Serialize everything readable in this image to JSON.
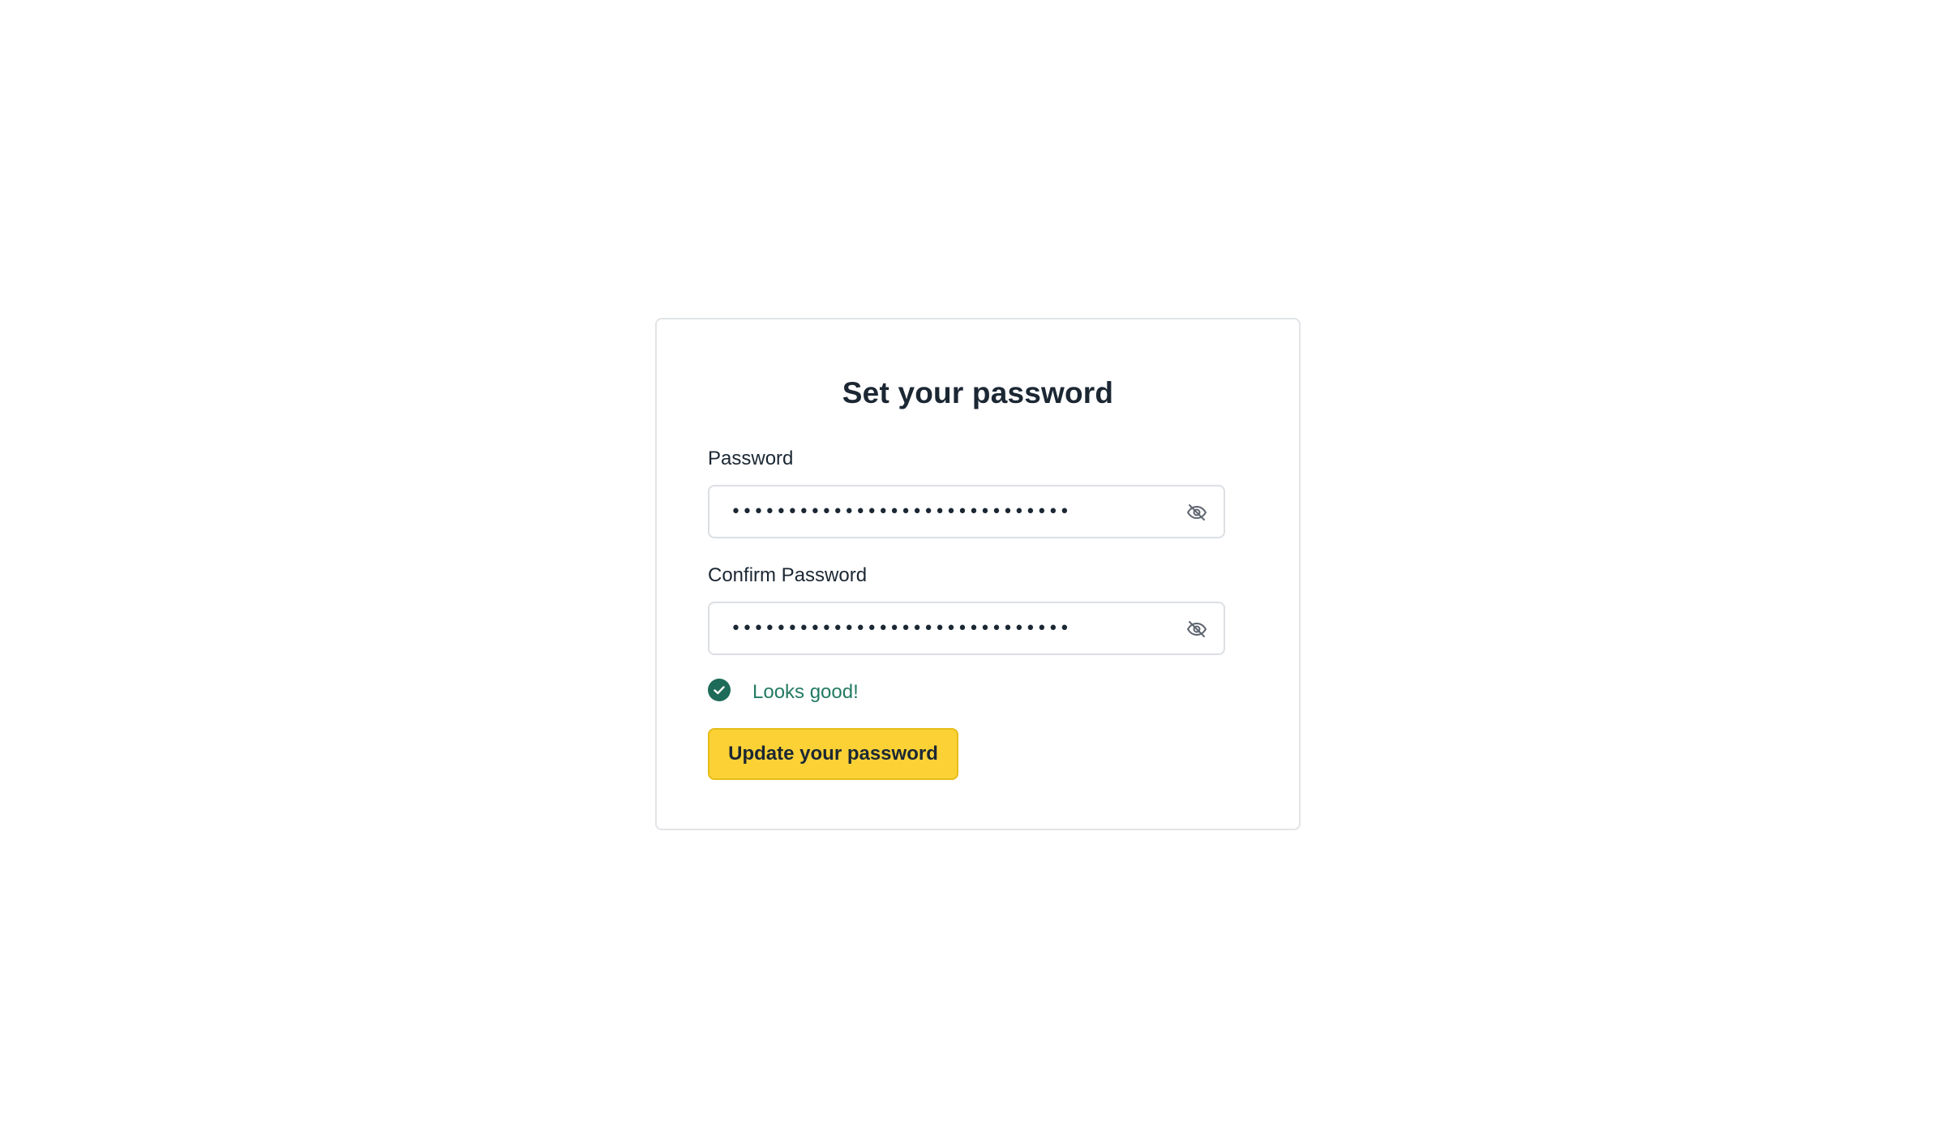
{
  "form": {
    "title": "Set your password",
    "password": {
      "label": "Password",
      "value": "••••••••••••••••••••••••••••••",
      "toggle_icon": "eye-off-icon"
    },
    "confirm_password": {
      "label": "Confirm Password",
      "value": "••••••••••••••••••••••••••••••",
      "toggle_icon": "eye-off-icon"
    },
    "validation": {
      "icon": "check-circle-icon",
      "message": "Looks good!",
      "color": "#237a63"
    },
    "submit": {
      "label": "Update your password",
      "color": "#fbd136"
    }
  }
}
